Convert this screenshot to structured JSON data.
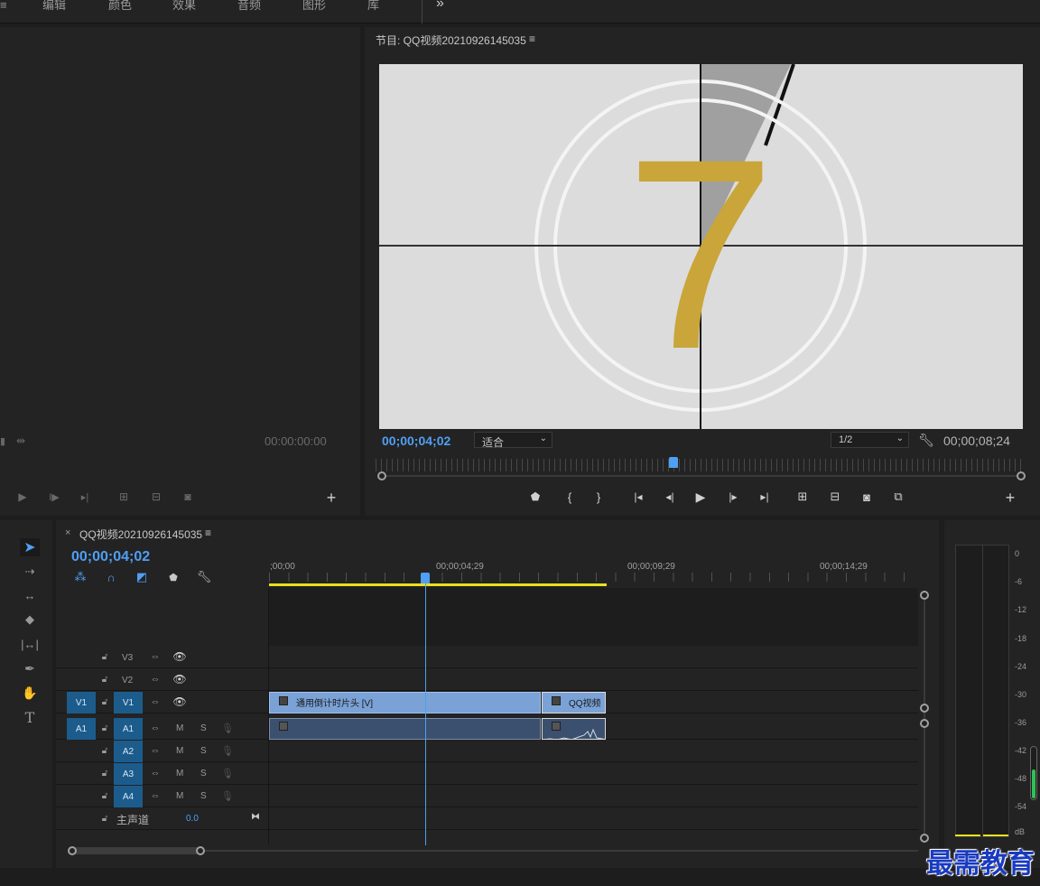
{
  "workspace_tabs": [
    "编辑",
    "颜色",
    "效果",
    "音频",
    "图形",
    "库"
  ],
  "overflow_icon": "»",
  "source_monitor": {
    "timecode": "00:00:00:00"
  },
  "program_monitor": {
    "title": "节目: QQ视频20210926145035",
    "current_timecode": "00;00;04;02",
    "fit_select": "适合",
    "resolution_select": "1/2",
    "duration_timecode": "00;00;08;24",
    "countdown_number": "7"
  },
  "timeline": {
    "tab_close": "×",
    "title": "QQ视频20210926145035",
    "current_timecode": "00;00;04;02",
    "ruler_labels": [
      ";00;00",
      "00;00;04;29",
      "00;00;09;29",
      "00;00;14;29"
    ],
    "video_tracks": [
      {
        "name": "V3",
        "source": ""
      },
      {
        "name": "V2",
        "source": ""
      },
      {
        "name": "V1",
        "source": "V1"
      }
    ],
    "audio_tracks": [
      {
        "name": "A1",
        "source": "A1",
        "m": "M",
        "s": "S"
      },
      {
        "name": "A2",
        "source": "",
        "m": "M",
        "s": "S"
      },
      {
        "name": "A3",
        "source": "",
        "m": "M",
        "s": "S"
      },
      {
        "name": "A4",
        "source": "",
        "m": "M",
        "s": "S"
      }
    ],
    "master": {
      "label": "主声道",
      "value": "0.0"
    },
    "clips": {
      "video_clip_1": "通用倒计时片头 [V]",
      "video_clip_2": "QQ视频"
    }
  },
  "audio_meter": {
    "labels": [
      "0",
      "-6",
      "-12",
      "-18",
      "-24",
      "-30",
      "-36",
      "-42",
      "-48",
      "-54",
      "dB"
    ]
  },
  "watermark": "最需教育",
  "colors": {
    "accent_blue": "#4f9ff5",
    "track_blue": "#1c5c8c",
    "video_clip": "#7aa2d6",
    "audio_clip": "#3b4f6e",
    "countdown_gold": "#c9a53a",
    "work_area": "#e8e020"
  }
}
